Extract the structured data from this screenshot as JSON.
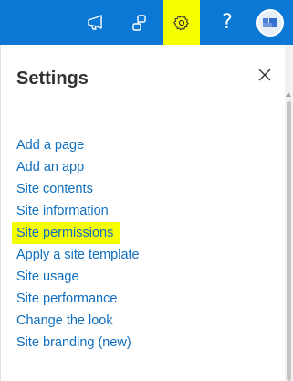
{
  "colors": {
    "topbar": "#0a78d4",
    "highlight": "#f6ff00",
    "link": "#106ebe",
    "title": "#323130"
  },
  "topbar": {
    "icons": [
      "megaphone-icon",
      "share-icon",
      "gear-icon",
      "help-icon",
      "avatar"
    ],
    "help_glyph": "?"
  },
  "panel": {
    "title": "Settings",
    "close_icon": "close-icon",
    "items": [
      {
        "label": "Add a page",
        "highlighted": false
      },
      {
        "label": "Add an app",
        "highlighted": false
      },
      {
        "label": "Site contents",
        "highlighted": false
      },
      {
        "label": "Site information",
        "highlighted": false
      },
      {
        "label": "Site permissions",
        "highlighted": true
      },
      {
        "label": "Apply a site template",
        "highlighted": false
      },
      {
        "label": "Site usage",
        "highlighted": false
      },
      {
        "label": "Site performance",
        "highlighted": false
      },
      {
        "label": "Change the look",
        "highlighted": false
      },
      {
        "label": "Site branding (new)",
        "highlighted": false
      }
    ]
  }
}
